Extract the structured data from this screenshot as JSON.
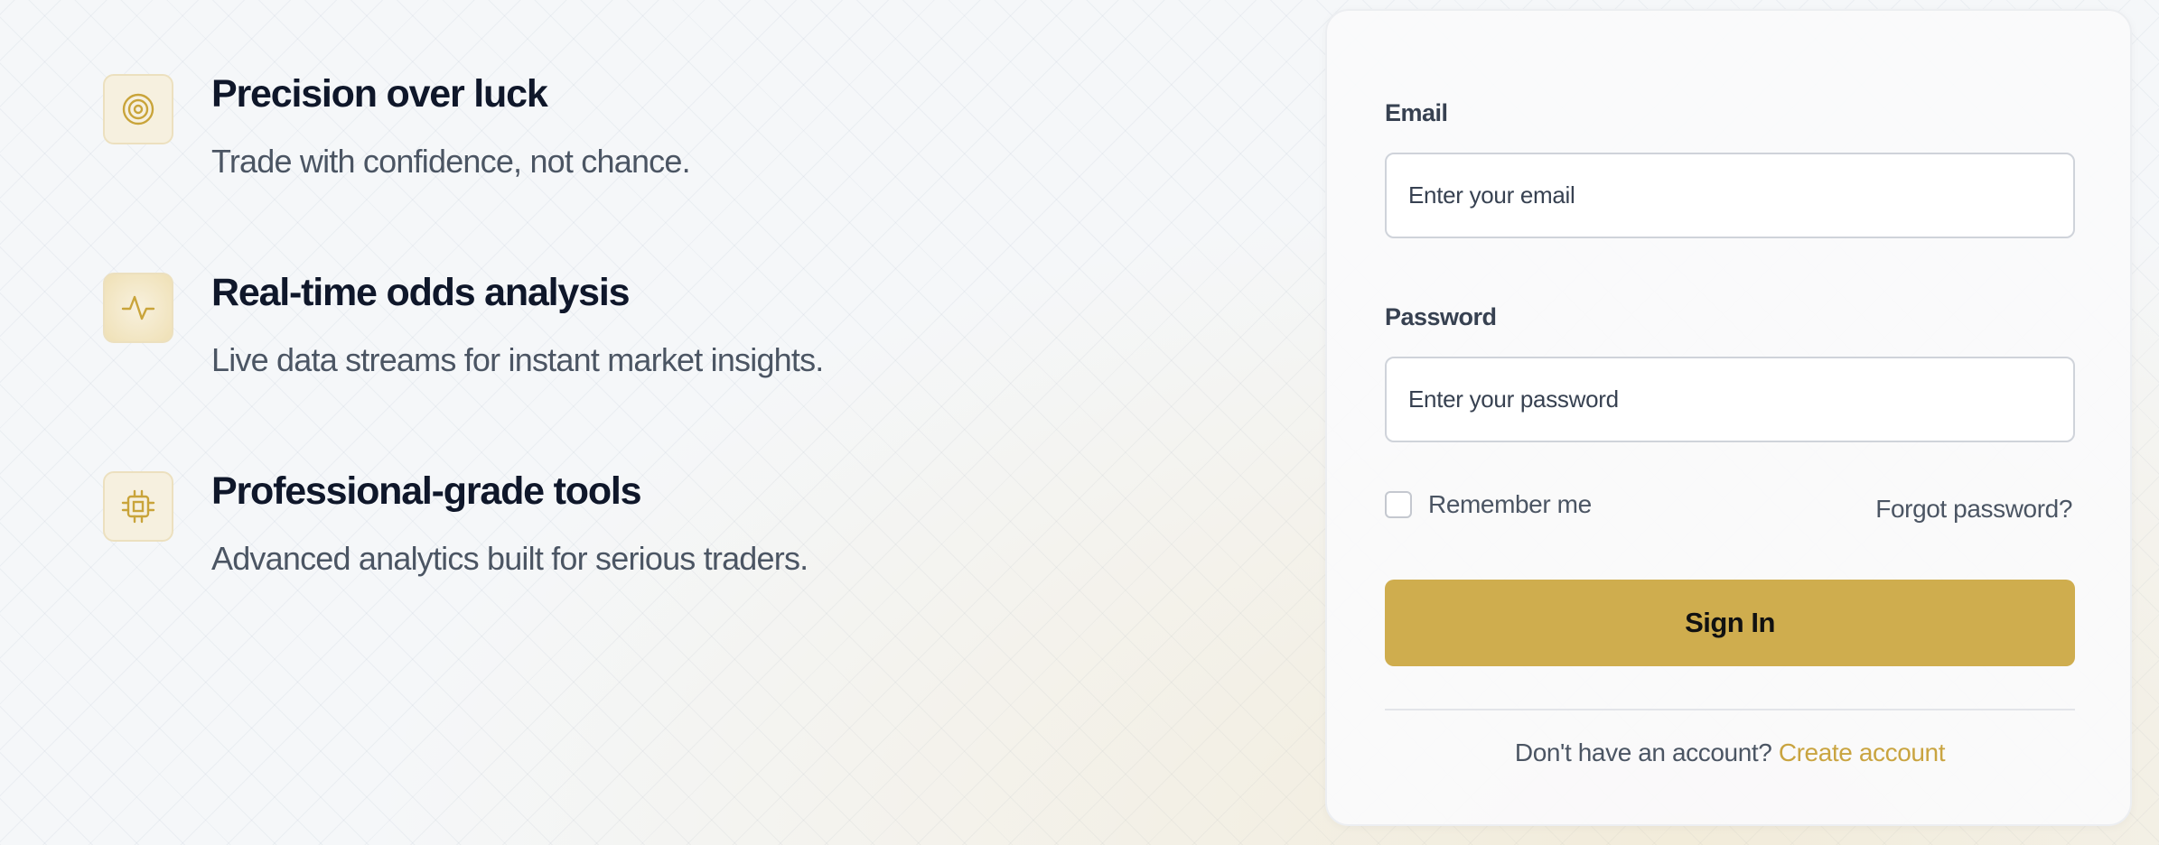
{
  "features": [
    {
      "icon": "target-icon",
      "title": "Precision over luck",
      "description": "Trade with confidence, not chance."
    },
    {
      "icon": "activity-icon",
      "title": "Real-time odds analysis",
      "description": "Live data streams for instant market insights."
    },
    {
      "icon": "chip-icon",
      "title": "Professional-grade tools",
      "description": "Advanced analytics built for serious traders."
    }
  ],
  "login": {
    "email_label": "Email",
    "email_placeholder": "Enter your email",
    "password_label": "Password",
    "password_placeholder": "Enter your password",
    "remember_label": "Remember me",
    "forgot_label": "Forgot password?",
    "submit_label": "Sign In",
    "signup_prompt": "Don't have an account?",
    "signup_link": "Create account"
  },
  "colors": {
    "accent": "#cfad4e",
    "accent_text": "#c9a440",
    "icon_stroke": "#c9a43a",
    "icon_background": "#f6f0df"
  }
}
